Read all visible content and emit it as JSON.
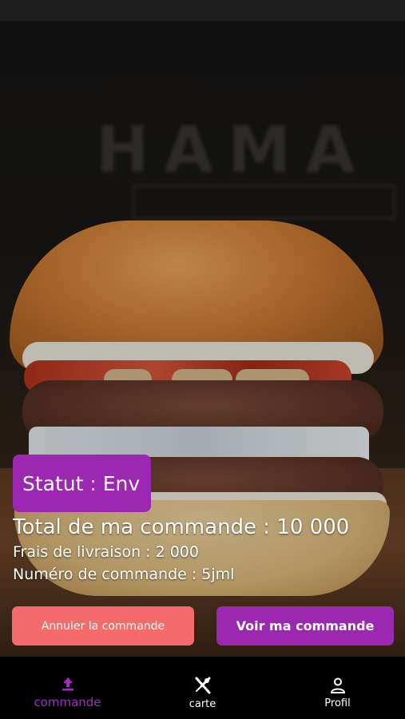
{
  "order": {
    "status_label": "Statut : Env",
    "total_label": "Total de ma commande : 10 000",
    "delivery_fee_label": "Frais de livraison : 2 000",
    "order_number_label": "Numéro de commande : 5jml"
  },
  "actions": {
    "cancel_label": "Annuler la commande",
    "view_label": "Voir ma commande"
  },
  "nav": {
    "items": [
      {
        "label": "commande",
        "icon": "upload-icon",
        "active": true
      },
      {
        "label": "carte",
        "icon": "cutlery-icon",
        "active": false
      },
      {
        "label": "Profil",
        "icon": "person-icon",
        "active": false
      }
    ]
  },
  "colors": {
    "accent": "#9c27b0",
    "cancel": "#f56b6b",
    "nav_active": "#a030c0"
  }
}
